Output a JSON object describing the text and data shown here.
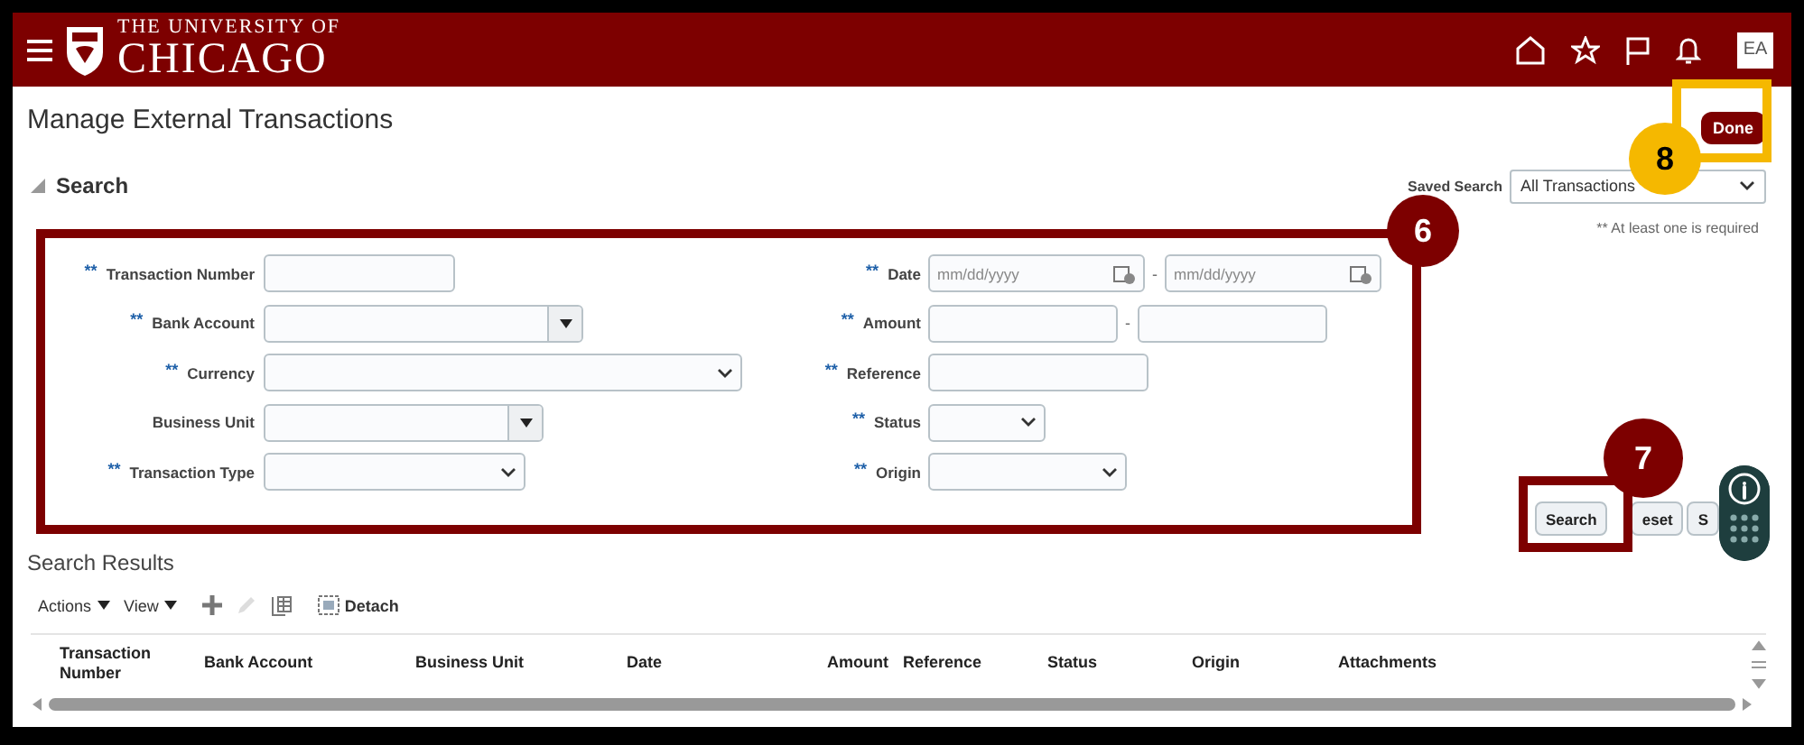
{
  "header": {
    "logo_line1": "THE UNIVERSITY OF",
    "logo_line2": "CHICAGO",
    "avatar": "EA"
  },
  "page": {
    "title": "Manage External Transactions",
    "done_button": "Done"
  },
  "search": {
    "heading": "Search",
    "expanded": true,
    "saved_search_label": "Saved Search",
    "saved_search_value": "All Transactions",
    "required_note": "** At least one is required",
    "left_fields": [
      {
        "label": "Transaction Number",
        "marker": "**",
        "kind": "text"
      },
      {
        "label": "Bank Account",
        "marker": "**",
        "kind": "combobox"
      },
      {
        "label": "Currency",
        "marker": "**",
        "kind": "select"
      },
      {
        "label": "Business Unit",
        "kind": "combobox"
      },
      {
        "label": "Transaction Type",
        "marker": "**",
        "kind": "select"
      }
    ],
    "right_fields": [
      {
        "label": "Date",
        "marker": "**",
        "kind": "date-range",
        "placeholders": [
          "mm/dd/yyyy",
          "mm/dd/yyyy"
        ],
        "separator": "-"
      },
      {
        "label": "Amount",
        "marker": "**",
        "kind": "range",
        "separator": "-"
      },
      {
        "label": "Reference",
        "marker": "**",
        "kind": "text"
      },
      {
        "label": "Status",
        "marker": "**",
        "kind": "select"
      },
      {
        "label": "Origin",
        "marker": "**",
        "kind": "select"
      }
    ],
    "buttons": [
      "Search",
      "eset",
      "S"
    ]
  },
  "results": {
    "title": "Search Results",
    "actions": "Actions",
    "view": "View",
    "detach": "Detach",
    "columns": [
      "Transaction Number",
      "Bank Account",
      "Business Unit",
      "Date",
      "Amount",
      "Reference",
      "Status",
      "Origin",
      "Attachments"
    ]
  },
  "annotations": [
    {
      "label": "6",
      "color": "#7d0000"
    },
    {
      "label": "7",
      "color": "#7d0000"
    },
    {
      "label": "8",
      "color": "#f5b800"
    }
  ]
}
